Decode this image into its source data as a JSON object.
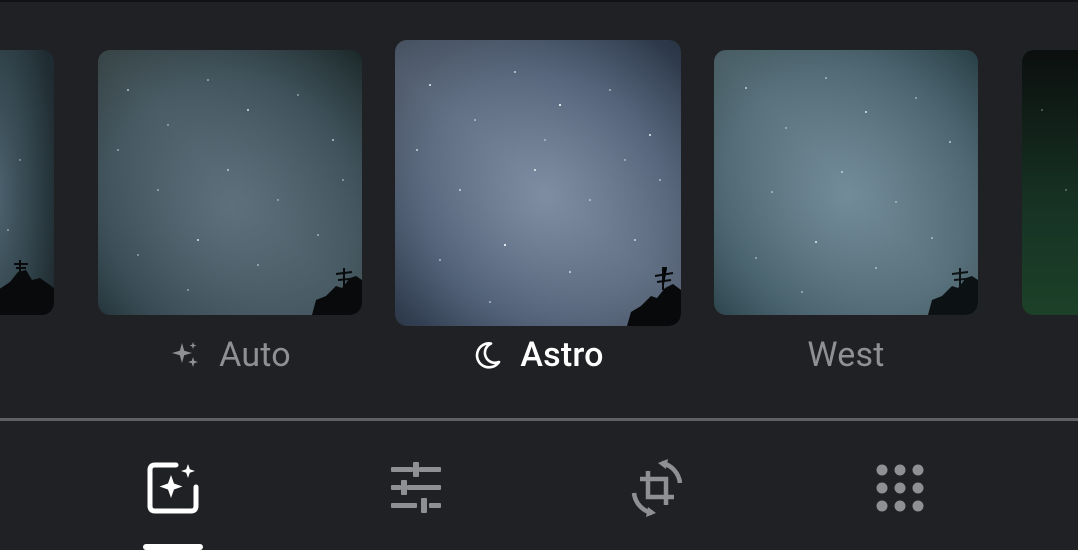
{
  "filters": [
    {
      "label": "",
      "icon": ""
    },
    {
      "label": "Auto",
      "icon": "sparkle-icon"
    },
    {
      "label": "Astro",
      "icon": "moon-icon",
      "selected": true
    },
    {
      "label": "West",
      "icon": ""
    },
    {
      "label": "",
      "icon": ""
    }
  ],
  "toolbar": {
    "tools": [
      {
        "name": "suggestions",
        "icon": "auto-enhance-icon",
        "selected": true
      },
      {
        "name": "adjust",
        "icon": "sliders-icon"
      },
      {
        "name": "crop",
        "icon": "crop-rotate-icon"
      },
      {
        "name": "filters",
        "icon": "filters-grid-icon"
      }
    ]
  },
  "colors": {
    "background": "#202124",
    "active_text": "#ffffff",
    "inactive_text": "#8e9094",
    "divider": "#5f6064"
  }
}
